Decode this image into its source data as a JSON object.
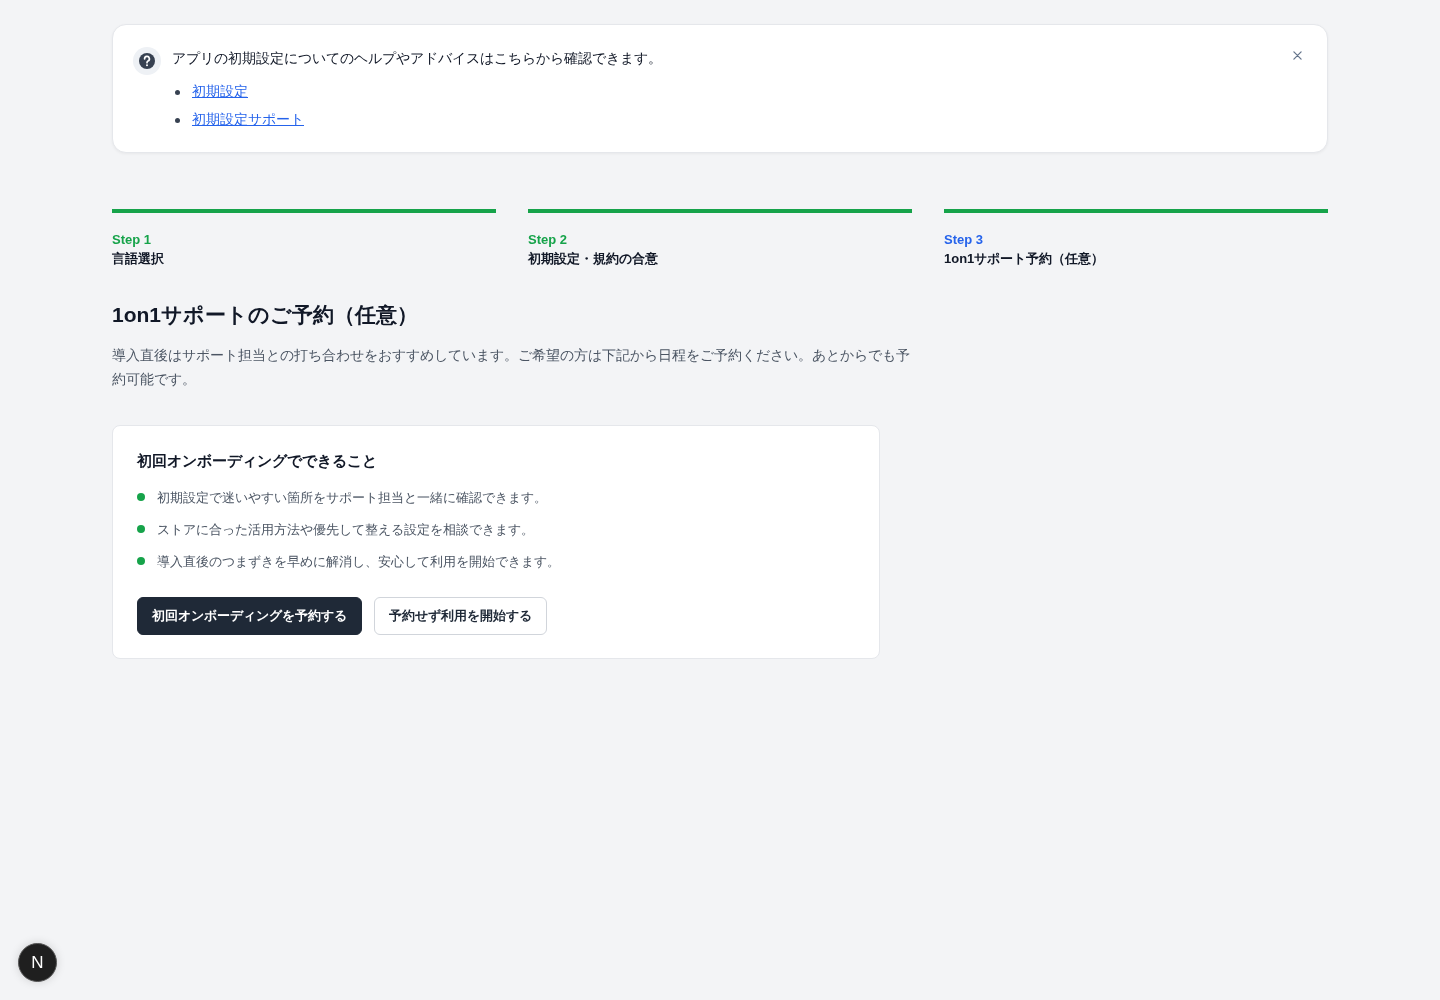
{
  "help_banner": {
    "message": "アプリの初期設定についてのヘルプやアドバイスはこちらから確認できます。",
    "links": [
      "初期設定",
      "初期設定サポート"
    ]
  },
  "steps": [
    {
      "label": "Step 1",
      "title": "言語選択",
      "selected": false,
      "on": true
    },
    {
      "label": "Step 2",
      "title": "初期設定・規約の合意",
      "selected": false,
      "on": true
    },
    {
      "label": "Step 3",
      "title": "1on1サポート予約（任意）",
      "selected": true,
      "on": true
    }
  ],
  "page": {
    "title": "1on1サポートのご予約（任意）",
    "description": "導入直後はサポート担当との打ち合わせをおすすめしています。ご希望の方は下記から日程をご予約ください。あとからでも予約可能です。"
  },
  "onboarding_card": {
    "title": "初回オンボーディングでできること",
    "items": [
      "初期設定で迷いやすい箇所をサポート担当と一緒に確認できます。",
      "ストアに合った活用方法や優先して整える設定を相談できます。",
      "導入直後のつまずきを早めに解消し、安心して利用を開始できます。"
    ],
    "buttons": [
      {
        "label": "初回オンボーディングを予約する",
        "kind": "primary"
      },
      {
        "label": "予約せず利用を開始する",
        "kind": "secondary"
      }
    ]
  },
  "dev_badge": {
    "label": "N"
  }
}
